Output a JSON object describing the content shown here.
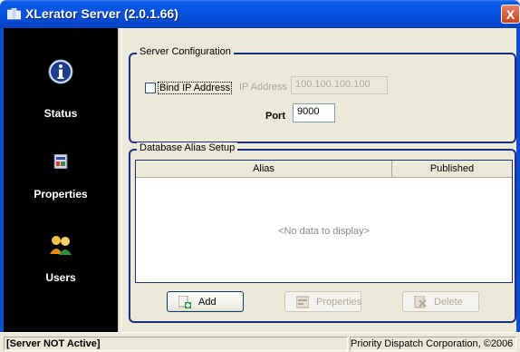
{
  "window": {
    "title": "XLerator Server (2.0.1.66)",
    "close_glyph": "X"
  },
  "sidebar": {
    "items": [
      {
        "label": "Status",
        "icon": "info-icon"
      },
      {
        "label": "Properties",
        "icon": "properties-icon"
      },
      {
        "label": "Users",
        "icon": "users-icon"
      }
    ]
  },
  "server_config": {
    "legend": "Server Configuration",
    "bind_ip_label": "Bind IP Address",
    "bind_ip_checked": false,
    "ip_label": "IP Address",
    "ip_value": "100.100.100.100",
    "port_label": "Port",
    "port_value": "9000"
  },
  "alias_setup": {
    "legend": "Database Alias Setup",
    "columns": [
      "Alias",
      "Published"
    ],
    "empty_text": "<No data to display>",
    "buttons": {
      "add": "Add",
      "properties": "Properties",
      "delete": "Delete"
    }
  },
  "status_bar": {
    "status": "[Server NOT Active]",
    "copyright": "Priority Dispatch Corporation, ©2006"
  },
  "colors": {
    "titlebar": "#0653e0",
    "sidebar": "#000000",
    "group_border": "#1b2f86"
  }
}
